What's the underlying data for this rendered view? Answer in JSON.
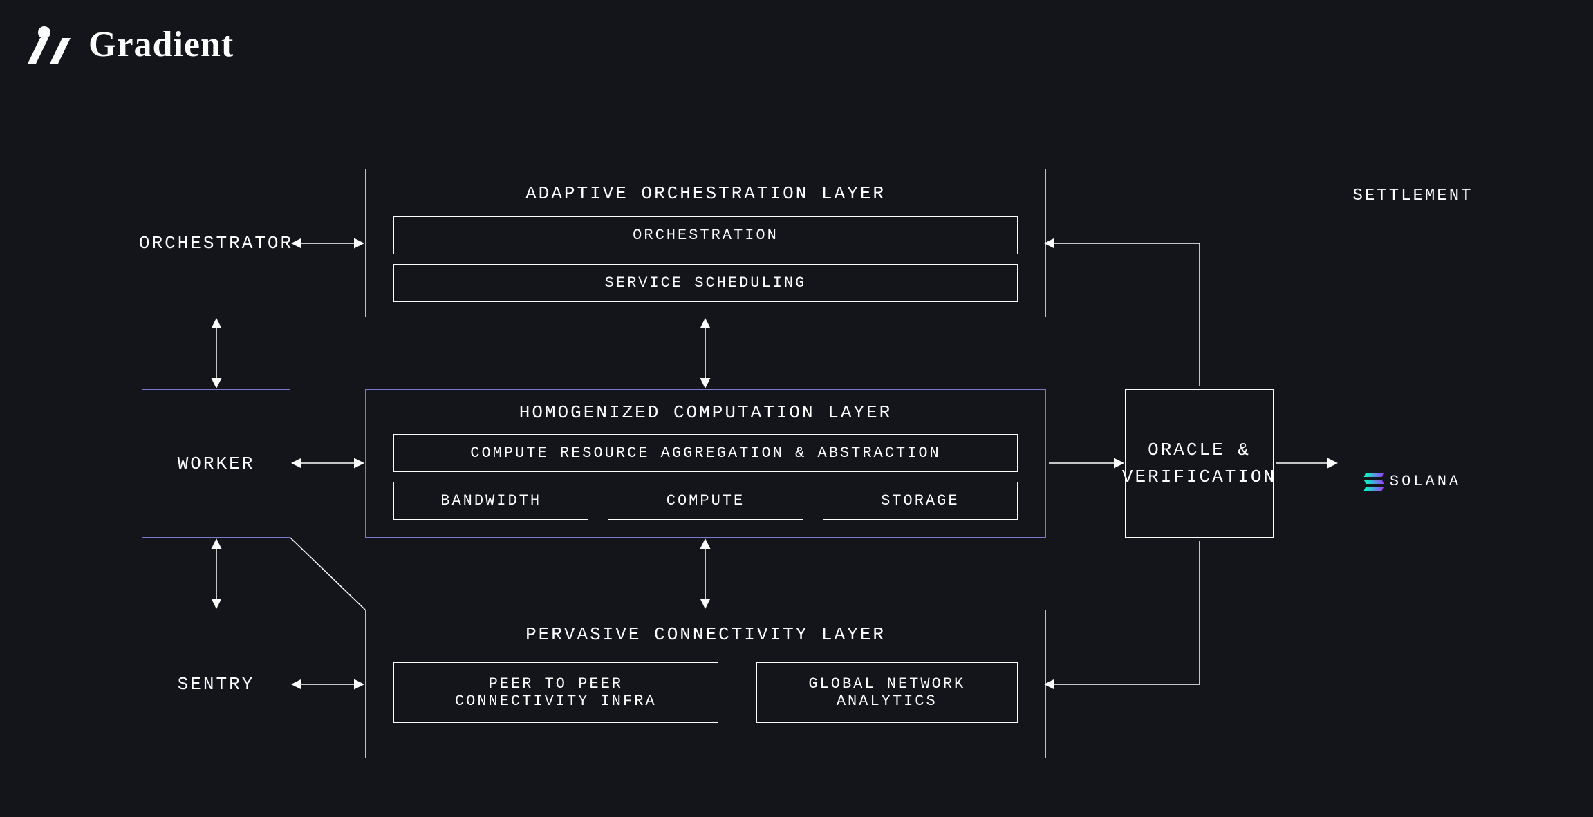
{
  "brand": {
    "name": "Gradient"
  },
  "left_column": {
    "orchestrator": "ORCHESTRATOR",
    "worker": "WORKER",
    "sentry": "SENTRY"
  },
  "layers": {
    "adaptive": {
      "title": "ADAPTIVE ORCHESTRATION LAYER",
      "items": [
        "ORCHESTRATION",
        "SERVICE SCHEDULING"
      ]
    },
    "homogenized": {
      "title": "HOMOGENIZED COMPUTATION LAYER",
      "aggregation": "COMPUTE RESOURCE AGGREGATION & ABSTRACTION",
      "sub": [
        "BANDWIDTH",
        "COMPUTE",
        "STORAGE"
      ]
    },
    "pervasive": {
      "title": "PERVASIVE CONNECTIVITY LAYER",
      "items": [
        "PEER TO PEER CONNECTIVITY INFRA",
        "GLOBAL NETWORK ANALYTICS"
      ]
    }
  },
  "oracle": "ORACLE & VERIFICATION",
  "settlement": {
    "title": "SETTLEMENT",
    "chain": "SOLANA"
  }
}
